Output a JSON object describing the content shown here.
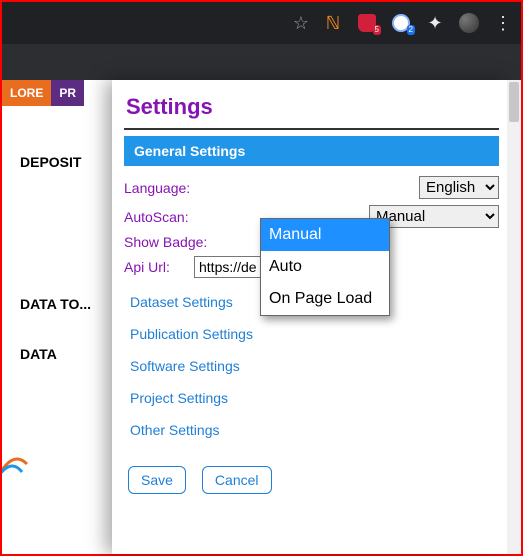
{
  "browser": {
    "icons": {
      "star": "☆",
      "rss": "ℕ",
      "puzzle": "✦",
      "kebab": "⋮"
    },
    "badges": {
      "shield": "5",
      "globe": "2"
    }
  },
  "page": {
    "tabs": [
      "LORE",
      "PR"
    ],
    "sidebar": [
      "DEPOSIT",
      "DATA TO...",
      "DATA"
    ]
  },
  "settings": {
    "title": "Settings",
    "section": "General Settings",
    "labels": {
      "language": "Language:",
      "autoscan": "AutoScan:",
      "showbadge": "Show Badge:",
      "apiurl": "Api Url:"
    },
    "language_value": "English",
    "autoscan_value": "Manual",
    "api_value": "https://de",
    "dropdown": [
      "Manual",
      "Auto",
      "On Page Load"
    ],
    "links": [
      "Dataset Settings",
      "Publication Settings",
      "Software Settings",
      "Project Settings",
      "Other Settings"
    ],
    "buttons": {
      "save": "Save",
      "cancel": "Cancel"
    }
  }
}
